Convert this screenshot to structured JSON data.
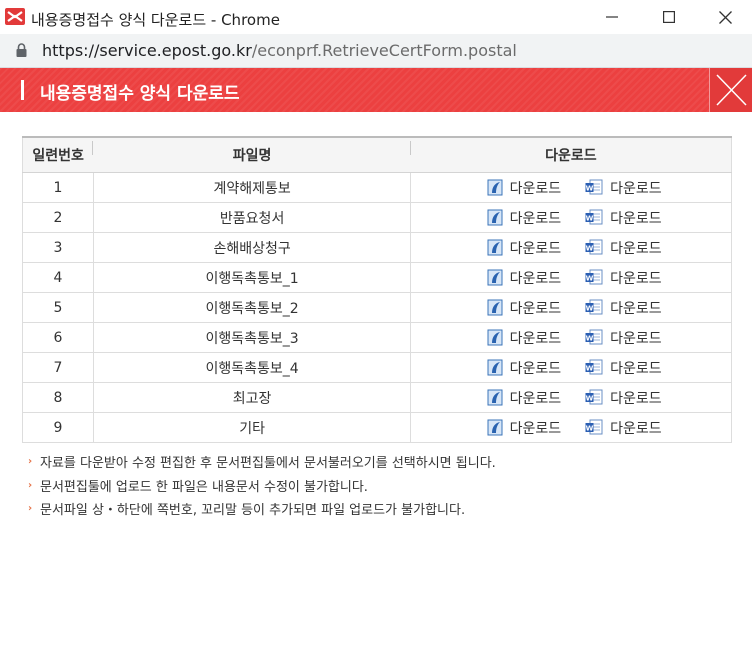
{
  "window": {
    "title": "내용증명접수 양식 다운로드 - Chrome"
  },
  "address": {
    "host": "https://service.epost.go.kr",
    "path": "/econprf.RetrieveCertForm.postal"
  },
  "header": {
    "title": "내용증명접수 양식 다운로드"
  },
  "table": {
    "columns": [
      "일련번호",
      "파일명",
      "다운로드"
    ],
    "rows": [
      {
        "no": "1",
        "name": "계약해제통보",
        "dl1": "다운로드",
        "dl2": "다운로드"
      },
      {
        "no": "2",
        "name": "반품요청서",
        "dl1": "다운로드",
        "dl2": "다운로드"
      },
      {
        "no": "3",
        "name": "손해배상청구",
        "dl1": "다운로드",
        "dl2": "다운로드"
      },
      {
        "no": "4",
        "name": "이행독촉통보_1",
        "dl1": "다운로드",
        "dl2": "다운로드"
      },
      {
        "no": "5",
        "name": "이행독촉통보_2",
        "dl1": "다운로드",
        "dl2": "다운로드"
      },
      {
        "no": "6",
        "name": "이행독촉통보_3",
        "dl1": "다운로드",
        "dl2": "다운로드"
      },
      {
        "no": "7",
        "name": "이행독촉통보_4",
        "dl1": "다운로드",
        "dl2": "다운로드"
      },
      {
        "no": "8",
        "name": "최고장",
        "dl1": "다운로드",
        "dl2": "다운로드"
      },
      {
        "no": "9",
        "name": "기타",
        "dl1": "다운로드",
        "dl2": "다운로드"
      }
    ]
  },
  "notes": [
    "자료를 다운받아 수정 편집한 후 문서편집툴에서 문서불러오기를 선택하시면 됩니다.",
    "문서편집툴에 업로드 한 파일은 내용문서 수정이 불가합니다.",
    "문서파일 상・하단에 쪽번호, 꼬리말 등이 추가되면 파일 업로드가 불가합니다."
  ],
  "icons": {
    "app": "epost-logo-icon",
    "lock": "lock-icon",
    "dl1": "hwp-file-icon",
    "dl2": "word-file-icon"
  },
  "colors": {
    "header_red": "#ec4040",
    "note_bullet": "#e5744a"
  }
}
